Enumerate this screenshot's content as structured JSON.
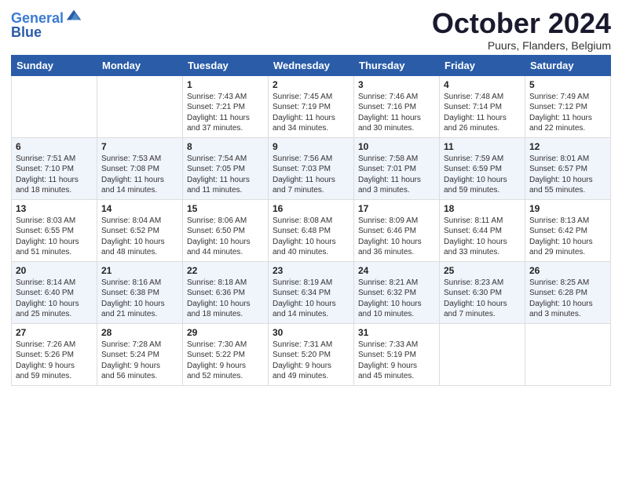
{
  "logo": {
    "line1": "General",
    "line2": "Blue"
  },
  "title": "October 2024",
  "location": "Puurs, Flanders, Belgium",
  "days_of_week": [
    "Sunday",
    "Monday",
    "Tuesday",
    "Wednesday",
    "Thursday",
    "Friday",
    "Saturday"
  ],
  "weeks": [
    [
      {
        "day": "",
        "content": ""
      },
      {
        "day": "",
        "content": ""
      },
      {
        "day": "1",
        "content": "Sunrise: 7:43 AM\nSunset: 7:21 PM\nDaylight: 11 hours\nand 37 minutes."
      },
      {
        "day": "2",
        "content": "Sunrise: 7:45 AM\nSunset: 7:19 PM\nDaylight: 11 hours\nand 34 minutes."
      },
      {
        "day": "3",
        "content": "Sunrise: 7:46 AM\nSunset: 7:16 PM\nDaylight: 11 hours\nand 30 minutes."
      },
      {
        "day": "4",
        "content": "Sunrise: 7:48 AM\nSunset: 7:14 PM\nDaylight: 11 hours\nand 26 minutes."
      },
      {
        "day": "5",
        "content": "Sunrise: 7:49 AM\nSunset: 7:12 PM\nDaylight: 11 hours\nand 22 minutes."
      }
    ],
    [
      {
        "day": "6",
        "content": "Sunrise: 7:51 AM\nSunset: 7:10 PM\nDaylight: 11 hours\nand 18 minutes."
      },
      {
        "day": "7",
        "content": "Sunrise: 7:53 AM\nSunset: 7:08 PM\nDaylight: 11 hours\nand 14 minutes."
      },
      {
        "day": "8",
        "content": "Sunrise: 7:54 AM\nSunset: 7:05 PM\nDaylight: 11 hours\nand 11 minutes."
      },
      {
        "day": "9",
        "content": "Sunrise: 7:56 AM\nSunset: 7:03 PM\nDaylight: 11 hours\nand 7 minutes."
      },
      {
        "day": "10",
        "content": "Sunrise: 7:58 AM\nSunset: 7:01 PM\nDaylight: 11 hours\nand 3 minutes."
      },
      {
        "day": "11",
        "content": "Sunrise: 7:59 AM\nSunset: 6:59 PM\nDaylight: 10 hours\nand 59 minutes."
      },
      {
        "day": "12",
        "content": "Sunrise: 8:01 AM\nSunset: 6:57 PM\nDaylight: 10 hours\nand 55 minutes."
      }
    ],
    [
      {
        "day": "13",
        "content": "Sunrise: 8:03 AM\nSunset: 6:55 PM\nDaylight: 10 hours\nand 51 minutes."
      },
      {
        "day": "14",
        "content": "Sunrise: 8:04 AM\nSunset: 6:52 PM\nDaylight: 10 hours\nand 48 minutes."
      },
      {
        "day": "15",
        "content": "Sunrise: 8:06 AM\nSunset: 6:50 PM\nDaylight: 10 hours\nand 44 minutes."
      },
      {
        "day": "16",
        "content": "Sunrise: 8:08 AM\nSunset: 6:48 PM\nDaylight: 10 hours\nand 40 minutes."
      },
      {
        "day": "17",
        "content": "Sunrise: 8:09 AM\nSunset: 6:46 PM\nDaylight: 10 hours\nand 36 minutes."
      },
      {
        "day": "18",
        "content": "Sunrise: 8:11 AM\nSunset: 6:44 PM\nDaylight: 10 hours\nand 33 minutes."
      },
      {
        "day": "19",
        "content": "Sunrise: 8:13 AM\nSunset: 6:42 PM\nDaylight: 10 hours\nand 29 minutes."
      }
    ],
    [
      {
        "day": "20",
        "content": "Sunrise: 8:14 AM\nSunset: 6:40 PM\nDaylight: 10 hours\nand 25 minutes."
      },
      {
        "day": "21",
        "content": "Sunrise: 8:16 AM\nSunset: 6:38 PM\nDaylight: 10 hours\nand 21 minutes."
      },
      {
        "day": "22",
        "content": "Sunrise: 8:18 AM\nSunset: 6:36 PM\nDaylight: 10 hours\nand 18 minutes."
      },
      {
        "day": "23",
        "content": "Sunrise: 8:19 AM\nSunset: 6:34 PM\nDaylight: 10 hours\nand 14 minutes."
      },
      {
        "day": "24",
        "content": "Sunrise: 8:21 AM\nSunset: 6:32 PM\nDaylight: 10 hours\nand 10 minutes."
      },
      {
        "day": "25",
        "content": "Sunrise: 8:23 AM\nSunset: 6:30 PM\nDaylight: 10 hours\nand 7 minutes."
      },
      {
        "day": "26",
        "content": "Sunrise: 8:25 AM\nSunset: 6:28 PM\nDaylight: 10 hours\nand 3 minutes."
      }
    ],
    [
      {
        "day": "27",
        "content": "Sunrise: 7:26 AM\nSunset: 5:26 PM\nDaylight: 9 hours\nand 59 minutes."
      },
      {
        "day": "28",
        "content": "Sunrise: 7:28 AM\nSunset: 5:24 PM\nDaylight: 9 hours\nand 56 minutes."
      },
      {
        "day": "29",
        "content": "Sunrise: 7:30 AM\nSunset: 5:22 PM\nDaylight: 9 hours\nand 52 minutes."
      },
      {
        "day": "30",
        "content": "Sunrise: 7:31 AM\nSunset: 5:20 PM\nDaylight: 9 hours\nand 49 minutes."
      },
      {
        "day": "31",
        "content": "Sunrise: 7:33 AM\nSunset: 5:19 PM\nDaylight: 9 hours\nand 45 minutes."
      },
      {
        "day": "",
        "content": ""
      },
      {
        "day": "",
        "content": ""
      }
    ]
  ]
}
